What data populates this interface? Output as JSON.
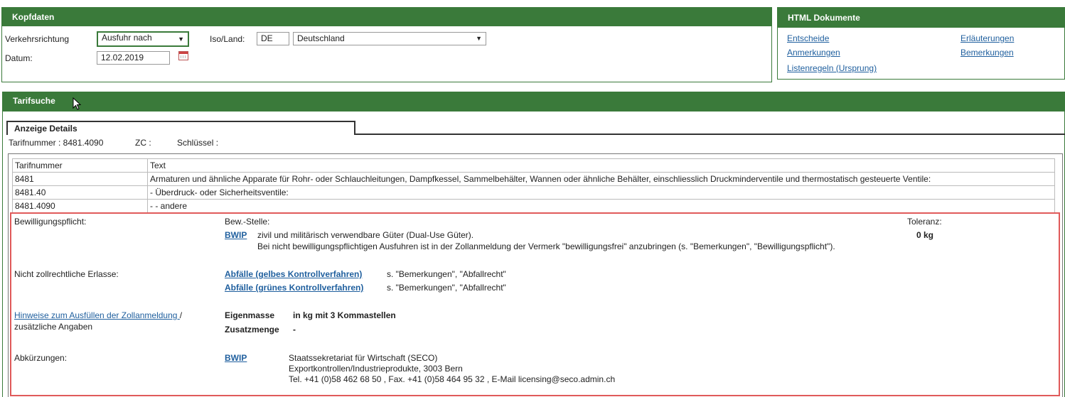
{
  "kopfdaten": {
    "title": "Kopfdaten",
    "verkehrsrichtung_label": "Verkehrsrichtung",
    "verkehrsrichtung_value": "Ausfuhr nach",
    "iso_label": "Iso/Land:",
    "iso_value": "DE",
    "land_value": "Deutschland",
    "datum_label": "Datum:",
    "datum_value": "12.02.2019"
  },
  "html_dokumente": {
    "title": "HTML Dokumente",
    "links": [
      "Entscheide",
      "Anmerkungen",
      "Listenregeln (Ursprung)",
      "Erläuterungen",
      "Bemerkungen"
    ]
  },
  "tarifsuche": {
    "title": "Tarifsuche",
    "tab_label": "Anzeige Details",
    "tarifnummer_label": "Tarifnummer : 8481.4090",
    "zc_label": "ZC :",
    "schluessel_label": "Schlüssel :"
  },
  "table": {
    "headers": [
      "Tarifnummer",
      "Text"
    ],
    "rows": [
      [
        "8481",
        "Armaturen und ähnliche Apparate für Rohr- oder Schlauchleitungen, Dampfkessel, Sammelbehälter, Wannen oder ähnliche Behälter, einschliesslich Druckminderventile und thermostatisch gesteuerte Ventile:"
      ],
      [
        "8481.40",
        "- Überdruck- oder Sicherheitsventile:"
      ],
      [
        "8481.4090",
        "- - andere"
      ]
    ]
  },
  "details": {
    "bewilligung_label": "Bewilligungspflicht:",
    "bewstelle_label": "Bew.-Stelle:",
    "toleranz_label": "Toleranz:",
    "bwip_link": "BWIP",
    "bwip_text1": "zivil und militärisch verwendbare Güter (Dual-Use Güter).",
    "bwip_text2": "Bei nicht bewilligungspflichtigen Ausfuhren ist in der Zollanmeldung der Vermerk \"bewilligungsfrei\" anzubringen (s. \"Bemerkungen\", \"Bewilligungspflicht\").",
    "toleranz_value": "0 kg",
    "erlasse_label": "Nicht zollrechtliche Erlasse:",
    "abfaelle1_link": "Abfälle (gelbes Kontrollverfahren)",
    "abfaelle1_text": "s. \"Bemerkungen\", \"Abfallrecht\"",
    "abfaelle2_link": "Abfälle (grünes Kontrollverfahren)",
    "abfaelle2_text": "s. \"Bemerkungen\", \"Abfallrecht\"",
    "hinweise_link": "Hinweise zum Ausfüllen der Zollanmeldung ",
    "hinweise_slash": "/",
    "hinweise_sub": "zusätzliche Angaben",
    "eigenmasse_label": "Eigenmasse",
    "eigenmasse_value": "in kg mit 3 Kommastellen",
    "zusatzmenge_label": "Zusatzmenge",
    "zusatzmenge_value": "-",
    "abk_label": "Abkürzungen:",
    "abk_link": "BWIP",
    "abk_line1": "Staatssekretariat für Wirtschaft (SECO)",
    "abk_line2": "Exportkontrollen/Industrieprodukte, 3003 Bern",
    "abk_line3": "Tel. +41 (0)58 462 68 50 , Fax. +41 (0)58 464 95 32 , E-Mail licensing@seco.admin.ch"
  }
}
